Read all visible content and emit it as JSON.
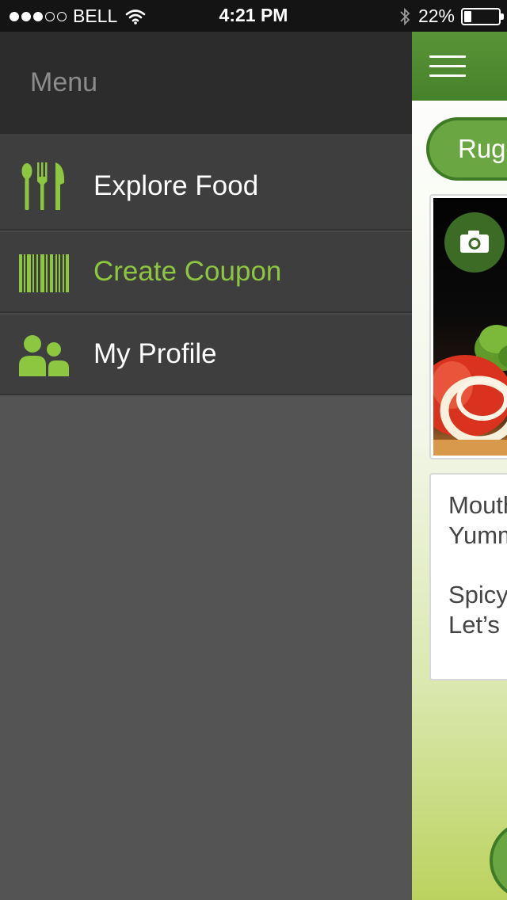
{
  "status_bar": {
    "carrier": "BELL",
    "time": "4:21 PM",
    "battery_percent": "22%",
    "battery_level": 0.22,
    "signal_bars_filled": 3,
    "signal_bars_total": 5
  },
  "menu": {
    "title": "Menu",
    "items": [
      {
        "label": "Explore Food",
        "icon": "fork-knife-spoon-icon",
        "active": false
      },
      {
        "label": "Create Coupon",
        "icon": "barcode-icon",
        "active": true
      },
      {
        "label": "My Profile",
        "icon": "people-icon",
        "active": false
      }
    ]
  },
  "main": {
    "pill_label": "Rugg",
    "description_lines": [
      "Mouth",
      "Yumm"
    ],
    "description_lines_2": [
      "Spicy",
      "Let’s"
    ]
  },
  "colors": {
    "accent_green": "#8dc63f",
    "navbar_green": "#4e8a30",
    "menu_bg": "#545454",
    "menu_header_bg": "#2c2c2c",
    "menu_item_bg": "#3e3e3e"
  }
}
